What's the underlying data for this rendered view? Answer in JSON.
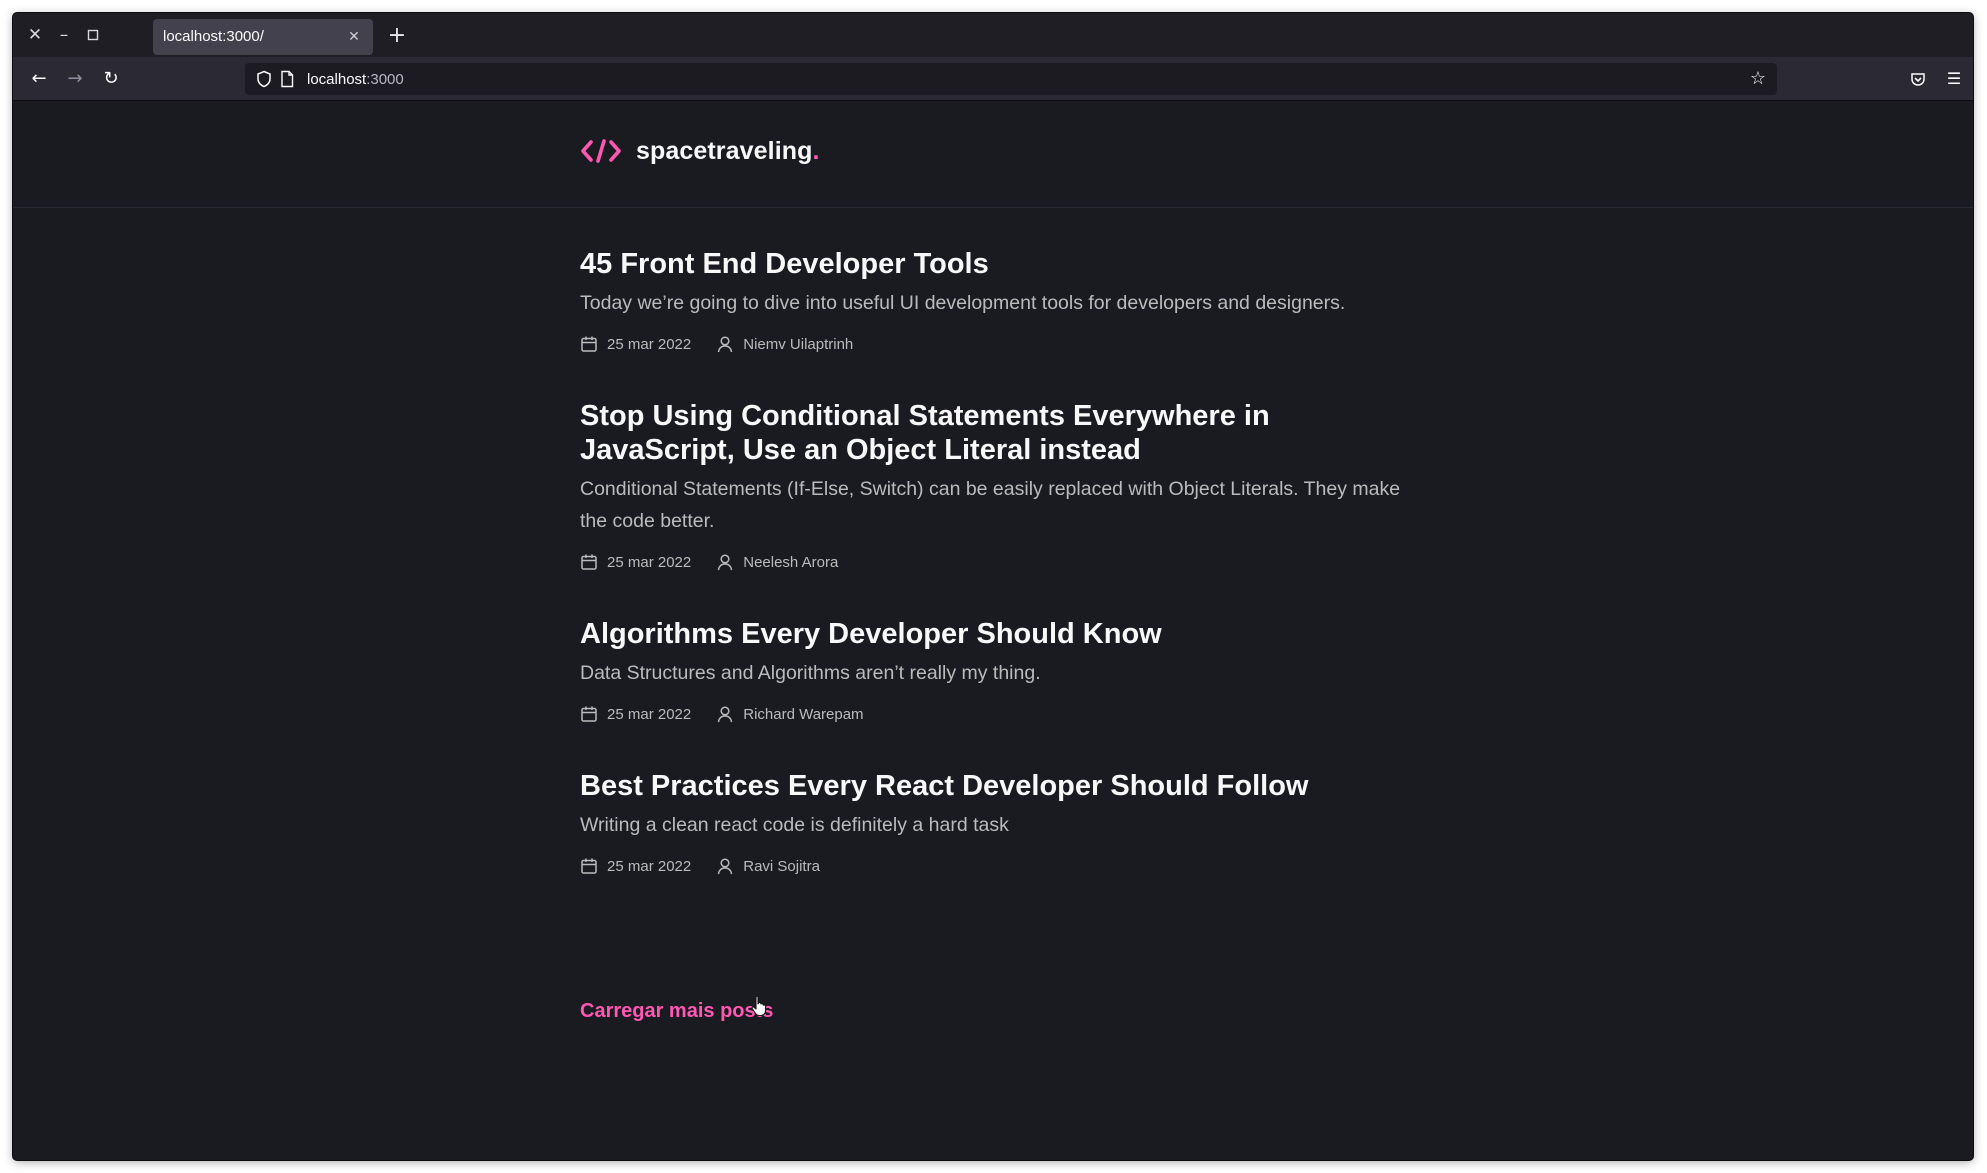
{
  "browser": {
    "tab_title": "localhost:3000/",
    "url_host": "localhost",
    "url_port": ":3000"
  },
  "site": {
    "logo_text": "spacetraveling",
    "logo_dot": ".",
    "accent_color": "#ff57b2"
  },
  "posts": [
    {
      "title": "45 Front End Developer Tools",
      "subtitle": "Today we’re going to dive into useful UI development tools for developers and designers.",
      "date": "25 mar 2022",
      "author": "Niemv Uilaptrinh"
    },
    {
      "title": "Stop Using Conditional Statements Everywhere in JavaScript, Use an Object Literal instead",
      "subtitle": "Conditional Statements (If-Else, Switch) can be easily replaced with Object Literals. They make the code better.",
      "date": "25 mar 2022",
      "author": "Neelesh Arora"
    },
    {
      "title": "Algorithms Every Developer Should Know",
      "subtitle": "Data Structures and Algorithms aren’t really my thing.",
      "date": "25 mar 2022",
      "author": "Richard Warepam"
    },
    {
      "title": "Best Practices Every React Developer Should Follow",
      "subtitle": "Writing a clean react code is definitely a hard task",
      "date": "25 mar 2022",
      "author": "Ravi Sojitra"
    }
  ],
  "load_more_label": "Carregar mais posts"
}
